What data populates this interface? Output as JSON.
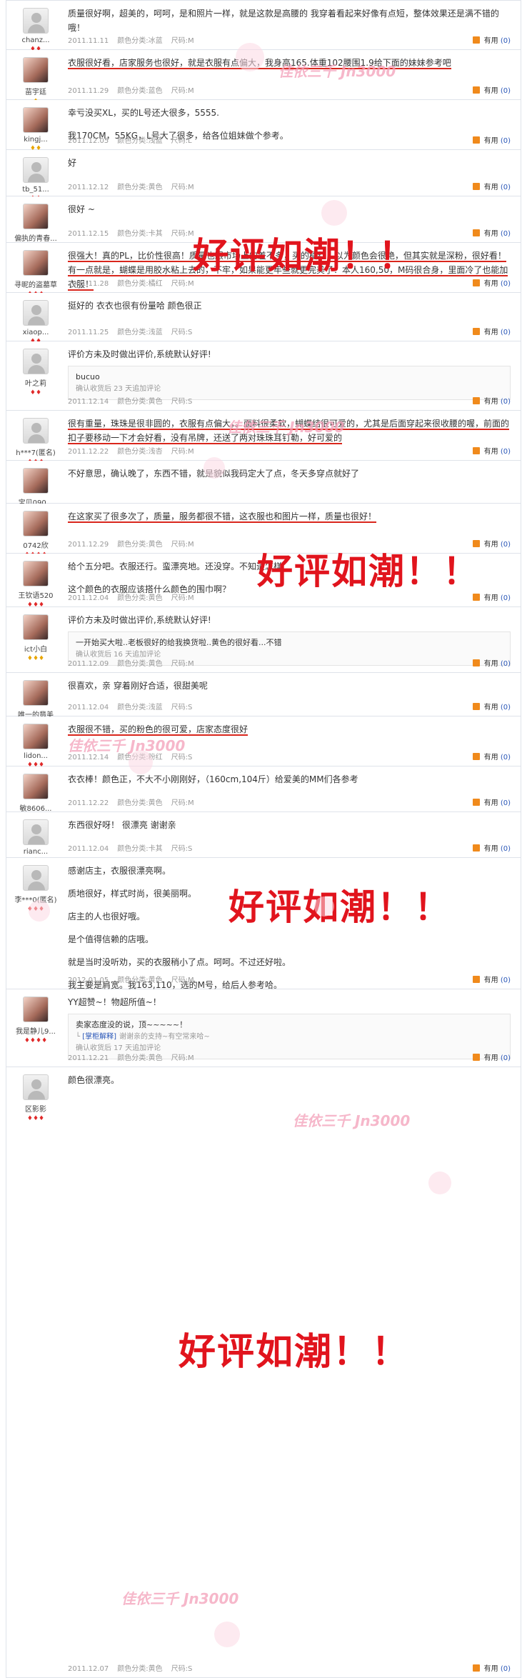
{
  "ui": {
    "color_label": "颜色分类:",
    "size_label": "尺码:",
    "useful_label": "有用",
    "reply_confirm_prefix": "确认收货后",
    "reply_confirm_suffix": "天追加评论"
  },
  "reviews": [
    {
      "user": "chanz...",
      "level": "red",
      "level_icons": "♦♦",
      "avatar": "default",
      "lines": [
        "质量很好啊，超美的，呵呵，是和照片一样，就是这款是高腰的 我穿着看起来好像有点短，整体效果还是满不错的哦！"
      ],
      "date": "2011.11.11",
      "color": "冰蓝",
      "size": "M",
      "useful": "(0)"
    },
    {
      "user": "苗宇廷",
      "level": "gold",
      "level_icons": "♦",
      "avatar": "photo",
      "lines": [
        "衣服很好看，店家服务也很好，就是衣服有点偏大，我身高165.体重102腰围1.9给下面的妹妹参考吧"
      ],
      "date": "2011.11.29",
      "color": "蓝色",
      "size": "M",
      "useful": "(0)"
    },
    {
      "user": "kingj...",
      "level": "gold",
      "level_icons": "♦♦",
      "avatar": "photo",
      "lines": [
        "幸亏没买XL，买的L号还大很多，5555.",
        "我170CM，55KG，L号大了很多，给各位姐妹做个参考。"
      ],
      "date": "2011.12.05",
      "color": "浅蓝",
      "size": "L",
      "useful": "(0)"
    },
    {
      "user": "tb_51...",
      "level": "red",
      "level_icons": "♦♦",
      "avatar": "default",
      "lines": [
        "好"
      ],
      "date": "2011.12.12",
      "color": "黄色",
      "size": "M",
      "useful": "(0)"
    },
    {
      "user": "偏执的青春...",
      "level": "red",
      "level_icons": "♦♦",
      "avatar": "photo",
      "lines": [
        "很好 ~"
      ],
      "date": "2011.12.15",
      "color": "卡其",
      "size": "M",
      "useful": "(0)"
    },
    {
      "user": "寻昵的盗墓草",
      "level": "red",
      "level_icons": "♦♦♦",
      "avatar": "photo",
      "lines": [
        "很强大！真的PL，比价性很高！质量也跟市场上的差不多，买的橘红，以为颜色会很艳，但其实就是深粉，很好看！有一点就是，蝴蝶是用胶水粘上去的，不牢，如果能更牢些就更完美了！本人160,50，M码很合身，里面冷了也能加衣服！"
      ],
      "date": "2011.11.28",
      "color": "橘红",
      "size": "M",
      "useful": "(0)"
    },
    {
      "user": "xiaop...",
      "level": "red",
      "level_icons": "♦♦",
      "avatar": "default",
      "lines": [
        "挺好的 衣衣也很有份量哈 颜色很正"
      ],
      "date": "2011.11.25",
      "color": "浅蓝",
      "size": "S",
      "useful": "(0)"
    },
    {
      "user": "叶之莉",
      "level": "red",
      "level_icons": "♦♦",
      "avatar": "default",
      "lines": [
        "评价方未及时做出评价,系统默认好评!"
      ],
      "reply": {
        "text": "bucuo",
        "days": "23"
      },
      "date": "2011.12.14",
      "color": "黄色",
      "size": "S",
      "useful": "(0)"
    },
    {
      "user": "h***7(匿名)",
      "level": "red",
      "level_icons": "♦♦♦",
      "avatar": "default",
      "lines": [
        "很有重量，珠珠是很非圆的，衣服有点偏大，。面料很柔软，蝴蝶结很可爱的，尤其是后面穿起来很收腰的喔，前面的扣子要移动一下才会好看，没有吊牌，还送了两对珠珠耳钉勒，好可爱的"
      ],
      "date": "2011.12.22",
      "color": "浅杏",
      "size": "M",
      "useful": "(0)"
    },
    {
      "user": "宝贝090...",
      "level": "red",
      "level_icons": "♦♦",
      "avatar": "photo",
      "lines": [
        "不好意思，确认晚了，东西不错，就是貌似我码定大了点，冬天多穿点就好了"
      ],
      "date": "",
      "color": "",
      "size": "",
      "useful": ""
    },
    {
      "user": "0742欣",
      "level": "red",
      "level_icons": "♦♦♦♦",
      "avatar": "photo",
      "lines": [
        "在这家买了很多次了，质量，服务都很不错，这衣服也和图片一样，质量也很好！"
      ],
      "date": "2011.12.29",
      "color": "黄色",
      "size": "M",
      "useful": "(0)"
    },
    {
      "user": "王钦语520",
      "level": "red",
      "level_icons": "♦♦♦",
      "avatar": "photo",
      "lines": [
        "给个五分吧。衣服还行。蛮漂亮地。还没穿。不知道怎样",
        "这个颜色的衣服应该搭什么颜色的围巾啊？"
      ],
      "date": "2011.12.04",
      "color": "黄色",
      "size": "M",
      "useful": "(0)"
    },
    {
      "user": "ict小白",
      "level": "gold",
      "level_icons": "♦♦♦",
      "avatar": "photo",
      "lines": [
        "评价方未及时做出评价,系统默认好评!"
      ],
      "reply": {
        "text": "一开始买大啦..老板很好的给我换货啦..黄色的很好看...不错",
        "days": "16"
      },
      "date": "2011.12.09",
      "color": "黄色",
      "size": "M",
      "useful": "(0)"
    },
    {
      "user": "唯一的翡美",
      "level": "red",
      "level_icons": "♦♦",
      "avatar": "photo",
      "lines": [
        "很喜欢，亲 穿着刚好合适，很甜美呢"
      ],
      "date": "2011.12.04",
      "color": "浅蓝",
      "size": "S",
      "useful": "(0)"
    },
    {
      "user": "lidon...",
      "level": "red",
      "level_icons": "♦♦♦",
      "avatar": "photo",
      "lines": [
        "衣服很不错，买的粉色的很可爱，店家态度很好"
      ],
      "date": "2011.12.14",
      "color": "粉红",
      "size": "S",
      "useful": "(0)"
    },
    {
      "user": "敏8606...",
      "level": "red",
      "level_icons": "♦♦♦",
      "avatar": "photo",
      "lines": [
        "衣衣棒！颜色正，不大不小刚刚好，（160cm,104斤）给爱美的MM们各参考"
      ],
      "date": "2011.12.22",
      "color": "黄色",
      "size": "M",
      "useful": "(0)"
    },
    {
      "user": "rianc...",
      "level": "gold",
      "level_icons": "♦",
      "avatar": "default",
      "lines": [
        "东西很好呀！ 很漂亮 谢谢亲"
      ],
      "date": "2011.12.04",
      "color": "卡其",
      "size": "S",
      "useful": "(0)"
    },
    {
      "user": "李***0(匿名)",
      "level": "red",
      "level_icons": "♦♦♦",
      "avatar": "default",
      "lines": [
        "感谢店主，衣服很漂亮啊。",
        "质地很好，样式时尚，很美丽啊。",
        "店主的人也很好哦。",
        "是个值得信赖的店哦。",
        "就是当时没听劝，买的衣服稍小了点。呵呵。不过还好啦。",
        "我主要是肩宽。我163,110，选的M号，给后人参考哈。"
      ],
      "date": "2012.01.05",
      "color": "黄色",
      "size": "M",
      "useful": "(0)"
    },
    {
      "user": "我是静儿9...",
      "level": "red",
      "level_icons": "♦♦♦♦",
      "avatar": "photo",
      "lines": [
        "YY超赞~！物超所值~！"
      ],
      "reply": {
        "text": "卖家态度没的说，顶~~~~~！",
        "seller_tag": "[掌柜解释]",
        "seller_text": "谢谢亲的支持~有空常来哈~",
        "days": "17"
      },
      "date": "2011.12.21",
      "color": "黄色",
      "size": "M",
      "useful": "(0)"
    },
    {
      "user": "区影影",
      "level": "red",
      "level_icons": "♦♦♦",
      "avatar": "default",
      "lines": [
        "颜色很漂亮。"
      ],
      "date": "2011.12.07",
      "color": "黄色",
      "size": "S",
      "useful": "(0)"
    }
  ],
  "overlay": {
    "stamp": "好评如潮！！",
    "watermark": "佳依三千 Jn3000"
  }
}
